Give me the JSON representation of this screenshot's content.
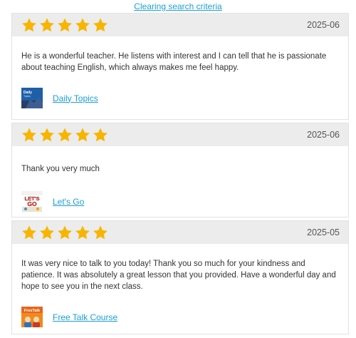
{
  "top_link": "Clearing search criteria",
  "colors": {
    "link": "#1a9fd6",
    "star": "#f7b500",
    "header_bg": "#ececec"
  },
  "reviews": [
    {
      "rating": 5,
      "date": "2025-06",
      "comment": "He is a wonderful teacher. He listens with interest and I can tell that he is passionate about teaching English, which always makes me feel happy.",
      "course": {
        "name": "Daily Topics",
        "thumb_icon": "daily-topics-thumbnail",
        "thumb_text": "Daily Topics"
      }
    },
    {
      "rating": 5,
      "date": "2025-06",
      "comment": "Thank you very much",
      "course": {
        "name": "Let's Go",
        "thumb_icon": "lets-go-thumbnail",
        "thumb_text": "LET'S GO"
      }
    },
    {
      "rating": 5,
      "date": "2025-05",
      "comment": "It was very nice to talk to you today! Thank you so much for your kindness and patience. It was absolutely a great lesson that you provided. Have a wonderful day and hope to see you in the next class.",
      "course": {
        "name": "Free Talk Course",
        "thumb_icon": "free-talk-thumbnail",
        "thumb_text": "FreeTalk"
      }
    }
  ]
}
